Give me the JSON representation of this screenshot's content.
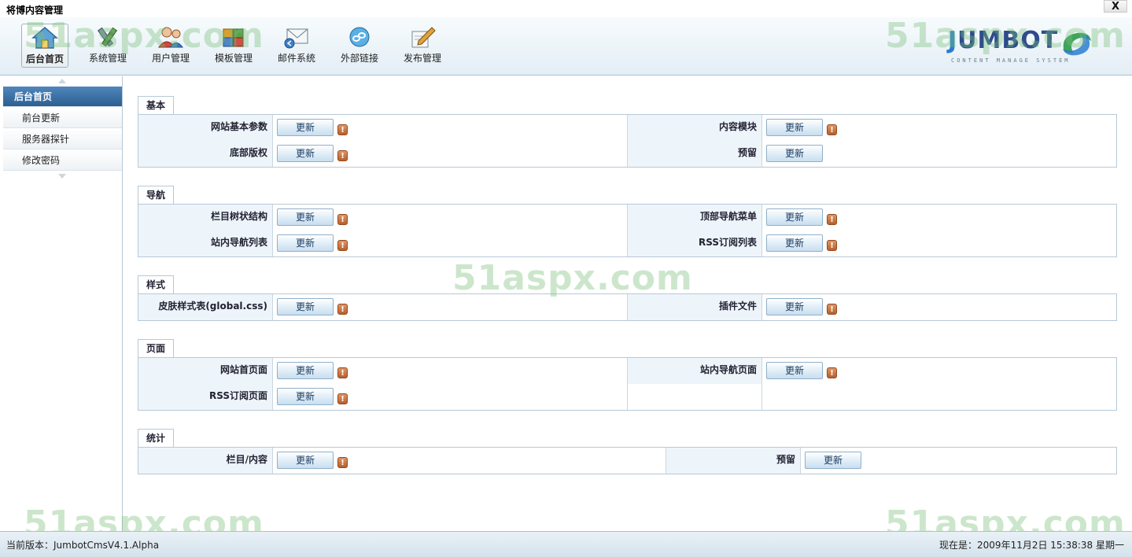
{
  "window": {
    "title": "将博内容管理",
    "close_label": "X"
  },
  "toolbar": {
    "items": [
      {
        "label": "后台首页",
        "icon": "home-icon"
      },
      {
        "label": "系统管理",
        "icon": "tools-icon"
      },
      {
        "label": "用户管理",
        "icon": "users-icon"
      },
      {
        "label": "模板管理",
        "icon": "puzzle-icon"
      },
      {
        "label": "邮件系统",
        "icon": "mail-icon"
      },
      {
        "label": "外部链接",
        "icon": "link-icon"
      },
      {
        "label": "发布管理",
        "icon": "pencil-icon"
      }
    ],
    "active_index": 0
  },
  "logo": {
    "text_j": "J",
    "text_rest": "UMBOT",
    "subtitle": "CONTENT MANAGE SYSTEM"
  },
  "watermark": "51aspx.com",
  "sidebar": {
    "items": [
      {
        "label": "后台首页"
      },
      {
        "label": "前台更新"
      },
      {
        "label": "服务器探针"
      },
      {
        "label": "修改密码"
      }
    ]
  },
  "sections": [
    {
      "title": "基本",
      "rows": [
        {
          "l1": "网站基本参数",
          "b1": "更新",
          "l2": "内容模块",
          "b2": "更新"
        },
        {
          "l1": "底部版权",
          "b1": "更新",
          "l2": "预留",
          "b2": "更新"
        }
      ]
    },
    {
      "title": "导航",
      "rows": [
        {
          "l1": "栏目树状结构",
          "b1": "更新",
          "l2": "顶部导航菜单",
          "b2": "更新"
        },
        {
          "l1": "站内导航列表",
          "b1": "更新",
          "l2": "RSS订阅列表",
          "b2": "更新"
        }
      ]
    },
    {
      "title": "样式",
      "rows": [
        {
          "l1": "皮肤样式表(global.css)",
          "b1": "更新",
          "l2": "插件文件",
          "b2": "更新"
        }
      ]
    },
    {
      "title": "页面",
      "rows": [
        {
          "l1": "网站首页面",
          "b1": "更新",
          "l2": "站内导航页面",
          "b2": "更新"
        },
        {
          "l1": "RSS订阅页面",
          "b1": "更新"
        }
      ]
    },
    {
      "title": "统计",
      "rows": [
        {
          "l1": "栏目/内容",
          "b1": "更新",
          "l2": "预留",
          "b2": "更新"
        }
      ]
    }
  ],
  "warn_glyph": "!",
  "status": {
    "version": "当前版本：JumbotCmsV4.1.Alpha",
    "now": "现在是：2009年11月2日 15:38:38  星期一"
  }
}
